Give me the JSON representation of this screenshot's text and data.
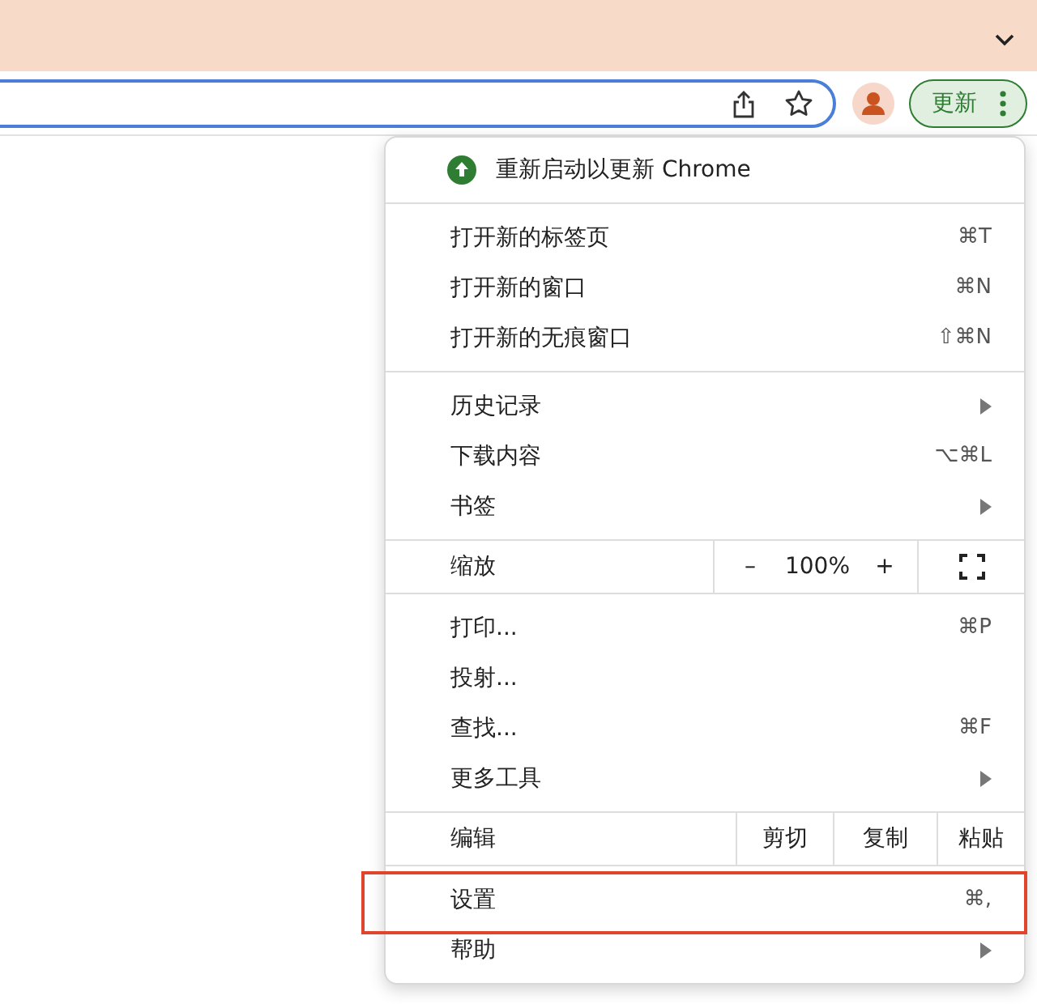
{
  "toolbar": {
    "update_button": {
      "label": "更新"
    }
  },
  "menu": {
    "sections": [
      [
        {
          "kind": "header",
          "label": "重新启动以更新 Chrome"
        }
      ],
      [
        {
          "kind": "item",
          "label": "打开新的标签页",
          "shortcut": "⌘T",
          "submenu": false,
          "highlighted": false
        },
        {
          "kind": "item",
          "label": "打开新的窗口",
          "shortcut": "⌘N",
          "submenu": false,
          "highlighted": false
        },
        {
          "kind": "item",
          "label": "打开新的无痕窗口",
          "shortcut": "⇧⌘N",
          "submenu": false,
          "highlighted": false
        }
      ],
      [
        {
          "kind": "item",
          "label": "历史记录",
          "submenu": true,
          "highlighted": false
        },
        {
          "kind": "item",
          "label": "下载内容",
          "shortcut": "⌥⌘L",
          "submenu": false,
          "highlighted": false
        },
        {
          "kind": "item",
          "label": "书签",
          "submenu": true,
          "highlighted": false
        }
      ],
      [
        {
          "kind": "zoom",
          "label": "缩放",
          "minus": "–",
          "value": "100%",
          "plus": "+"
        }
      ],
      [
        {
          "kind": "item",
          "label": "打印...",
          "shortcut": "⌘P",
          "submenu": false,
          "highlighted": false
        },
        {
          "kind": "item",
          "label": "投射...",
          "submenu": false,
          "highlighted": false
        },
        {
          "kind": "item",
          "label": "查找...",
          "shortcut": "⌘F",
          "submenu": false,
          "highlighted": false
        },
        {
          "kind": "item",
          "label": "更多工具",
          "submenu": true,
          "highlighted": false
        }
      ],
      [
        {
          "kind": "edit",
          "label": "编辑",
          "buttons": [
            "剪切",
            "复制",
            "粘贴"
          ]
        }
      ],
      [
        {
          "kind": "item",
          "label": "设置",
          "shortcut": "⌘,",
          "submenu": false,
          "highlighted": true
        },
        {
          "kind": "item",
          "label": "帮助",
          "submenu": true,
          "highlighted": false
        }
      ]
    ]
  }
}
